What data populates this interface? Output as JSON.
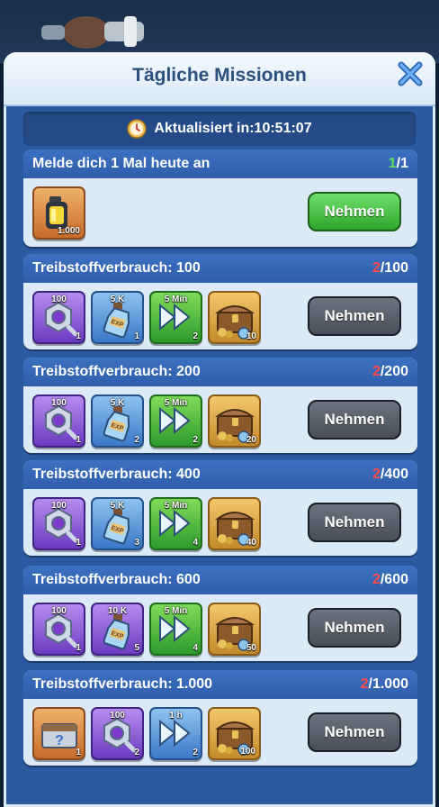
{
  "window": {
    "title": "Tägliche Missionen"
  },
  "timer": {
    "label": "Aktualisiert in:",
    "value": "10:51:07"
  },
  "missions": [
    {
      "title": "Melde dich 1 Mal heute an",
      "progress_current": "1",
      "progress_total": "/1",
      "progress_color": "green",
      "button_label": "Nehmen",
      "button_state": "active",
      "rewards": [
        {
          "icon": "fuel-can-icon",
          "style": "orange",
          "label": "",
          "count": "1.000"
        }
      ]
    },
    {
      "title": "Treibstoffverbrauch: 100",
      "progress_current": "2",
      "progress_total": "/100",
      "progress_color": "red",
      "button_label": "Nehmen",
      "button_state": "disabled",
      "rewards": [
        {
          "icon": "hex-nut-icon",
          "style": "purple",
          "label": "100",
          "count": "1"
        },
        {
          "icon": "exp-bottle-icon",
          "style": "blue",
          "label": "5 K",
          "count": "1"
        },
        {
          "icon": "speedup-arrows-icon",
          "style": "green",
          "label": "5 Min",
          "count": "2"
        },
        {
          "icon": "treasure-chest-icon",
          "style": "gold",
          "label": "",
          "count": "10"
        }
      ]
    },
    {
      "title": "Treibstoffverbrauch: 200",
      "progress_current": "2",
      "progress_total": "/200",
      "progress_color": "red",
      "button_label": "Nehmen",
      "button_state": "disabled",
      "rewards": [
        {
          "icon": "hex-nut-icon",
          "style": "purple",
          "label": "100",
          "count": "1"
        },
        {
          "icon": "exp-bottle-icon",
          "style": "blue",
          "label": "5 K",
          "count": "2"
        },
        {
          "icon": "speedup-arrows-icon",
          "style": "green",
          "label": "5 Min",
          "count": "2"
        },
        {
          "icon": "treasure-chest-icon",
          "style": "gold",
          "label": "",
          "count": "20"
        }
      ]
    },
    {
      "title": "Treibstoffverbrauch: 400",
      "progress_current": "2",
      "progress_total": "/400",
      "progress_color": "red",
      "button_label": "Nehmen",
      "button_state": "disabled",
      "rewards": [
        {
          "icon": "hex-nut-icon",
          "style": "purple",
          "label": "100",
          "count": "1"
        },
        {
          "icon": "exp-bottle-icon",
          "style": "blue",
          "label": "5 K",
          "count": "3"
        },
        {
          "icon": "speedup-arrows-icon",
          "style": "green",
          "label": "5 Min",
          "count": "4"
        },
        {
          "icon": "treasure-chest-icon",
          "style": "gold",
          "label": "",
          "count": "40"
        }
      ]
    },
    {
      "title": "Treibstoffverbrauch: 600",
      "progress_current": "2",
      "progress_total": "/600",
      "progress_color": "red",
      "button_label": "Nehmen",
      "button_state": "disabled",
      "rewards": [
        {
          "icon": "hex-nut-icon",
          "style": "purple",
          "label": "100",
          "count": "1"
        },
        {
          "icon": "exp-bottle-icon",
          "style": "purple",
          "label": "10 K",
          "count": "5"
        },
        {
          "icon": "speedup-arrows-icon",
          "style": "green",
          "label": "5 Min",
          "count": "4"
        },
        {
          "icon": "treasure-chest-icon",
          "style": "gold",
          "label": "",
          "count": "50"
        }
      ]
    },
    {
      "title": "Treibstoffverbrauch: 1.000",
      "progress_current": "2",
      "progress_total": "/1.000",
      "progress_color": "red",
      "button_label": "Nehmen",
      "button_state": "disabled",
      "rewards": [
        {
          "icon": "mystery-crate-icon",
          "style": "orange",
          "label": "",
          "count": "1"
        },
        {
          "icon": "hex-nut-icon",
          "style": "purple",
          "label": "100",
          "count": "2"
        },
        {
          "icon": "speedup-arrows-icon",
          "style": "blue",
          "label": "1 h",
          "count": "2"
        },
        {
          "icon": "treasure-chest-icon",
          "style": "gold",
          "label": "",
          "count": "100"
        }
      ]
    }
  ],
  "colors": {
    "panel_blue": "#2c5aa0",
    "card_header_blue": "#3c70c0",
    "progress_green": "#5fe05f",
    "progress_red": "#ff4949",
    "button_active": "#2ea52b",
    "button_disabled": "#484f59"
  }
}
